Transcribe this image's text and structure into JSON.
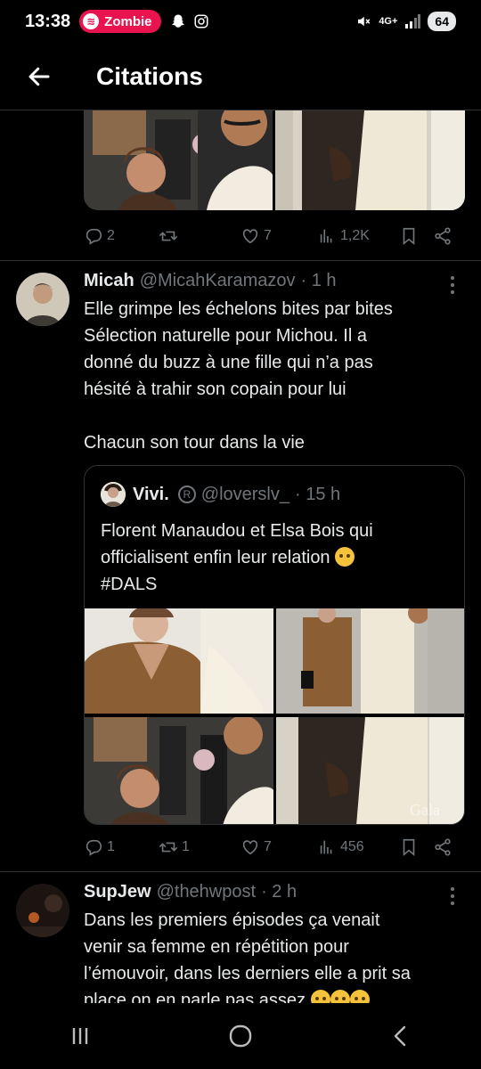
{
  "status_bar": {
    "time": "13:38",
    "spotify_chip": "Zombie",
    "network": "4G+",
    "battery": "64"
  },
  "header": {
    "title": "Citations"
  },
  "prev_tweet": {
    "replies": "2",
    "retweets": "",
    "likes": "7",
    "views": "1,2K"
  },
  "tweet1": {
    "name": "Micah",
    "handle": "@MicahKaramazov",
    "time": "· 1 h",
    "lines": [
      "Elle grimpe les échelons bites par bites",
      "Sélection naturelle pour Michou. Il a",
      "donné du buzz à une fille qui n’a pas",
      "hésité à trahir son copain pour lui",
      "",
      "Chacun son tour dans la vie"
    ],
    "quote": {
      "name": "Vivi.",
      "badge": "R",
      "handle": "@loverslv_",
      "time": "· 15 h",
      "lines": [
        "Florent Manaudou et Elsa Bois qui",
        "officialisent enfin leur relation",
        "#DALS"
      ],
      "watermark": "Gala"
    },
    "replies": "1",
    "retweets": "1",
    "likes": "7",
    "views": "456"
  },
  "tweet2": {
    "name": "SupJew",
    "handle": "@thehwpost",
    "time": "· 2 h",
    "lines": [
      "Dans les premiers épisodes ça venait",
      "venir sa femme en répétition pour",
      "l’émouvoir, dans les derniers elle a prit sa",
      "place on en parle pas assez"
    ]
  },
  "colors": {
    "background": "#000000",
    "text": "#e7e9ea",
    "muted": "#71767b",
    "spotify": "#e8134f"
  }
}
